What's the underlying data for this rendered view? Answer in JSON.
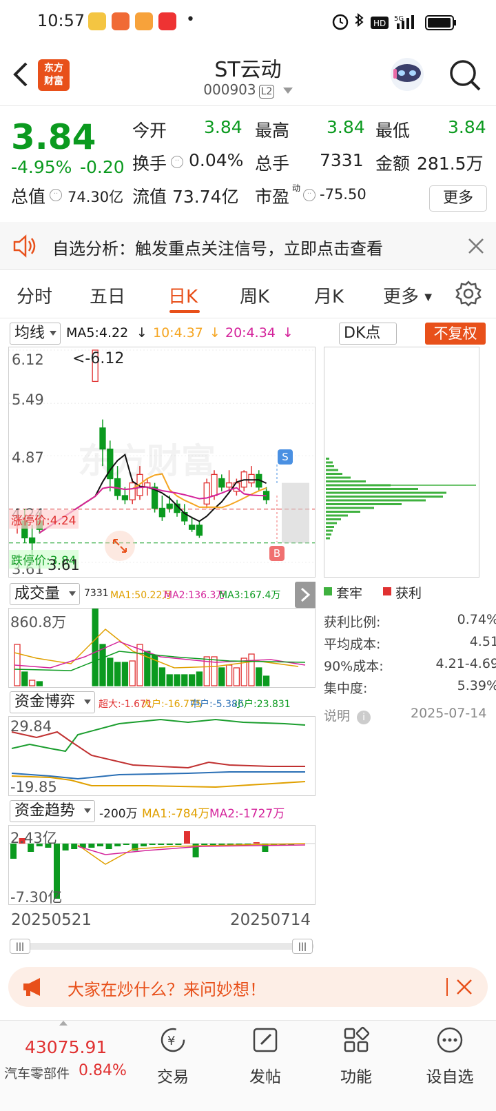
{
  "status_bar": {
    "time": "10:57",
    "dot": "•",
    "network": "5G"
  },
  "nav": {
    "logo_line1": "东方",
    "logo_line2": "财富",
    "title": "ST云动",
    "code": "000903",
    "level": "L2"
  },
  "quote": {
    "price": "3.84",
    "change_pct": "-4.95%",
    "change": "-0.20",
    "open_label": "今开",
    "open": "3.84",
    "high_label": "最高",
    "high": "3.84",
    "low_label": "最低",
    "low": "3.84",
    "turnover_label": "换手",
    "turnover": "0.04%",
    "volume_label": "总手",
    "volume": "7331",
    "amount_label": "金额",
    "amount": "281.5万",
    "mktcap_label": "总值",
    "mktcap": "74.30亿",
    "float_label": "流值",
    "float": "73.74亿",
    "pe_label": "市盈",
    "pe_sup": "动",
    "pe": "-75.50",
    "more": "更多"
  },
  "analysis": {
    "text": "自选分析：触发重点关注信号，立即点击查看"
  },
  "tabs": [
    "分时",
    "五日",
    "日K",
    "周K",
    "月K",
    "更多"
  ],
  "active_tab": 2,
  "kline": {
    "selector": "均线",
    "ma5": "MA5:4.22",
    "ma10": "10:4.37",
    "ma20": "20:4.34",
    "dk_selector": "DK点",
    "adj_button": "不复权",
    "y_labels": [
      "6.12",
      "5.49",
      "4.87",
      "4.24",
      "3.61"
    ],
    "max_marker": "<-6.12",
    "limit_up_label": "涨停价:4.24",
    "limit_down_label": "跌停价:3.84",
    "low_label": "3.61",
    "sell_badge": "S",
    "buy_badge": "B",
    "watermark": "东方财富"
  },
  "volume_panel": {
    "selector": "成交量",
    "value": "7331",
    "ma1": "MA1:50.22万",
    "ma2": "MA2:136.3万",
    "ma3": "MA3:167.4万",
    "max_label": "860.8万"
  },
  "capital_game": {
    "selector": "资金博弈",
    "super": "超大:-1.671",
    "large": "大户:-16.775",
    "mid": "中户:-5.386",
    "small": "小户:23.831",
    "top_label": "29.84",
    "bottom_label": "-19.85"
  },
  "capital_trend": {
    "selector": "资金趋势",
    "value": "-200万",
    "ma1": "MA1:-784万",
    "ma2": "MA2:-1727万",
    "top_label": "2.43亿",
    "bottom_label": "-7.30亿"
  },
  "dates": {
    "start": "20250521",
    "end": "20250714"
  },
  "chip": {
    "legend_trapped": "套牢",
    "legend_profit": "获利",
    "rows": [
      {
        "label": "获利比例:",
        "value": "0.74%"
      },
      {
        "label": "平均成本:",
        "value": "4.51"
      },
      {
        "label": "90%成本:",
        "value": "4.21-4.69"
      },
      {
        "label": "集中度:",
        "value": "5.39%"
      }
    ],
    "note_label": "说明",
    "note_date": "2025-07-14"
  },
  "banner": {
    "text": "大家在炒什么？来问妙想！"
  },
  "bottom_bar": {
    "index_value": "43075.91",
    "index_name": "汽车零部件",
    "index_change": "0.84%",
    "items": [
      "交易",
      "发帖",
      "功能",
      "设自选"
    ]
  },
  "colors": {
    "up": "#e03131",
    "down": "#0b9a1f",
    "accent": "#e8501a",
    "ma5": "#111111",
    "ma10": "#f5a623",
    "ma20": "#d4239b"
  },
  "kline_candles": [
    [
      4.05,
      4.24,
      3.95,
      4.1
    ],
    [
      4.1,
      4.24,
      3.84,
      3.9
    ],
    [
      3.9,
      4.05,
      3.61,
      3.84
    ],
    [
      4.1,
      4.2,
      3.95,
      4.0
    ],
    [
      5.75,
      6.12,
      5.75,
      6.12
    ],
    [
      5.2,
      5.3,
      4.75,
      4.95
    ],
    [
      4.95,
      5.05,
      4.45,
      4.6
    ],
    [
      4.6,
      4.75,
      4.35,
      4.4
    ],
    [
      4.4,
      4.5,
      4.3,
      4.35
    ],
    [
      4.35,
      4.6,
      4.3,
      4.55
    ],
    [
      4.4,
      4.75,
      4.35,
      4.65
    ],
    [
      4.5,
      4.6,
      4.4,
      4.55
    ],
    [
      4.5,
      4.55,
      4.2,
      4.25
    ],
    [
      4.25,
      4.4,
      4.1,
      4.15
    ],
    [
      4.3,
      4.4,
      4.2,
      4.25
    ],
    [
      4.3,
      4.35,
      4.15,
      4.2
    ],
    [
      4.2,
      4.3,
      4.05,
      4.1
    ],
    [
      4.05,
      4.15,
      3.97,
      4.0
    ],
    [
      4.05,
      4.1,
      3.9,
      3.93
    ],
    [
      4.3,
      4.6,
      4.25,
      4.55
    ],
    [
      4.4,
      4.7,
      4.35,
      4.65
    ],
    [
      4.6,
      4.65,
      4.45,
      4.5
    ],
    [
      4.5,
      4.7,
      4.45,
      4.55
    ],
    [
      4.45,
      4.6,
      4.4,
      4.55
    ],
    [
      4.5,
      4.7,
      4.45,
      4.68
    ],
    [
      4.55,
      4.75,
      4.5,
      4.65
    ],
    [
      4.65,
      4.7,
      4.45,
      4.5
    ],
    [
      4.45,
      4.5,
      4.3,
      4.35
    ]
  ]
}
